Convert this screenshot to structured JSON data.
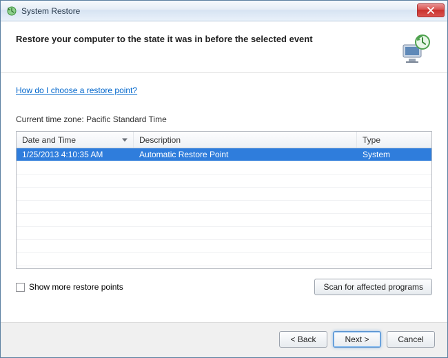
{
  "titlebar": {
    "title": "System Restore"
  },
  "heading": "Restore your computer to the state it was in before the selected event",
  "help_link": "How do I choose a restore point?",
  "timezone_label": "Current time zone: Pacific Standard Time",
  "table": {
    "headers": {
      "date": "Date and Time",
      "desc": "Description",
      "type": "Type"
    },
    "rows": [
      {
        "date": "1/25/2013 4:10:35 AM",
        "desc": "Automatic Restore Point",
        "type": "System"
      }
    ]
  },
  "show_more_label": "Show more restore points",
  "scan_button": "Scan for affected programs",
  "buttons": {
    "back": "< Back",
    "next": "Next >",
    "cancel": "Cancel"
  }
}
